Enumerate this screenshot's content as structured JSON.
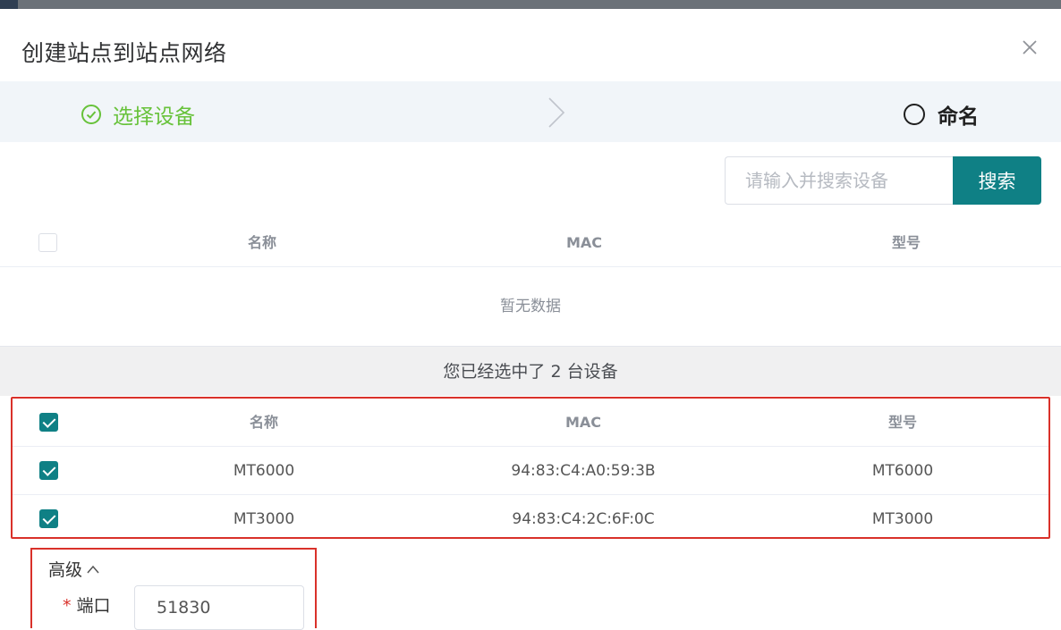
{
  "dialog": {
    "title": "创建站点到站点网络"
  },
  "steps": [
    {
      "label": "选择设备",
      "state": "done"
    },
    {
      "label": "命名",
      "state": "pending"
    }
  ],
  "search": {
    "placeholder": "请输入并搜索设备",
    "button_label": "搜索",
    "value": ""
  },
  "available_table": {
    "headers": [
      "名称",
      "MAC",
      "型号"
    ],
    "empty_text": "暂无数据"
  },
  "selected_summary": "您已经选中了 2 台设备",
  "selected_table": {
    "headers": [
      "名称",
      "MAC",
      "型号"
    ],
    "rows": [
      {
        "name": "MT6000",
        "mac": "94:83:C4:A0:59:3B",
        "model": "MT6000",
        "checked": true
      },
      {
        "name": "MT3000",
        "mac": "94:83:C4:2C:6F:0C",
        "model": "MT3000",
        "checked": true
      }
    ]
  },
  "advanced": {
    "title": "高级",
    "port_label": "端口",
    "port_required_mark": "*",
    "port_value": "51830"
  },
  "colors": {
    "primary": "#0f8085",
    "success": "#67c23a",
    "highlight": "#d9312a"
  }
}
